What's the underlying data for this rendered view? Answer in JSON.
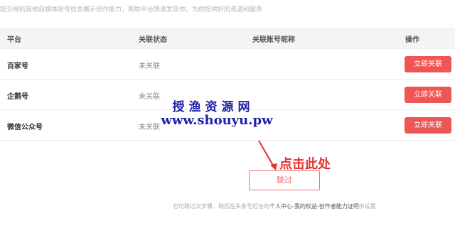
{
  "intro_text": "提交绑的其他自媒体账号信息展示创作能力，帮助平台快速发现你，为你提供好的资源和服务",
  "table": {
    "headers": {
      "platform": "平台",
      "status": "关联状态",
      "nickname": "关联账号昵称",
      "action": "操作"
    },
    "rows": [
      {
        "platform": "百家号",
        "status": "未关联",
        "button": "立即关联"
      },
      {
        "platform": "企鹅号",
        "status": "未关联",
        "button": "立即关联"
      },
      {
        "platform": "微信公众号",
        "status": "未关联",
        "button": "立即关联"
      }
    ]
  },
  "watermark": {
    "line1": "授渔资源网",
    "line2": "www.shouyu.pw"
  },
  "annotation": "点击此处",
  "skip_button": "跳过",
  "footer": {
    "prefix": "也可跳过次步骤，稍后在头条号后台的",
    "link1": "个人中心",
    "sep1": "-",
    "link2": "我的权益",
    "sep2": "-",
    "link3": "创作者能力证明",
    "suffix": "中设置"
  },
  "colors": {
    "accent": "#ee5555",
    "watermark": "#1e22a8",
    "annotation": "#e53030"
  }
}
